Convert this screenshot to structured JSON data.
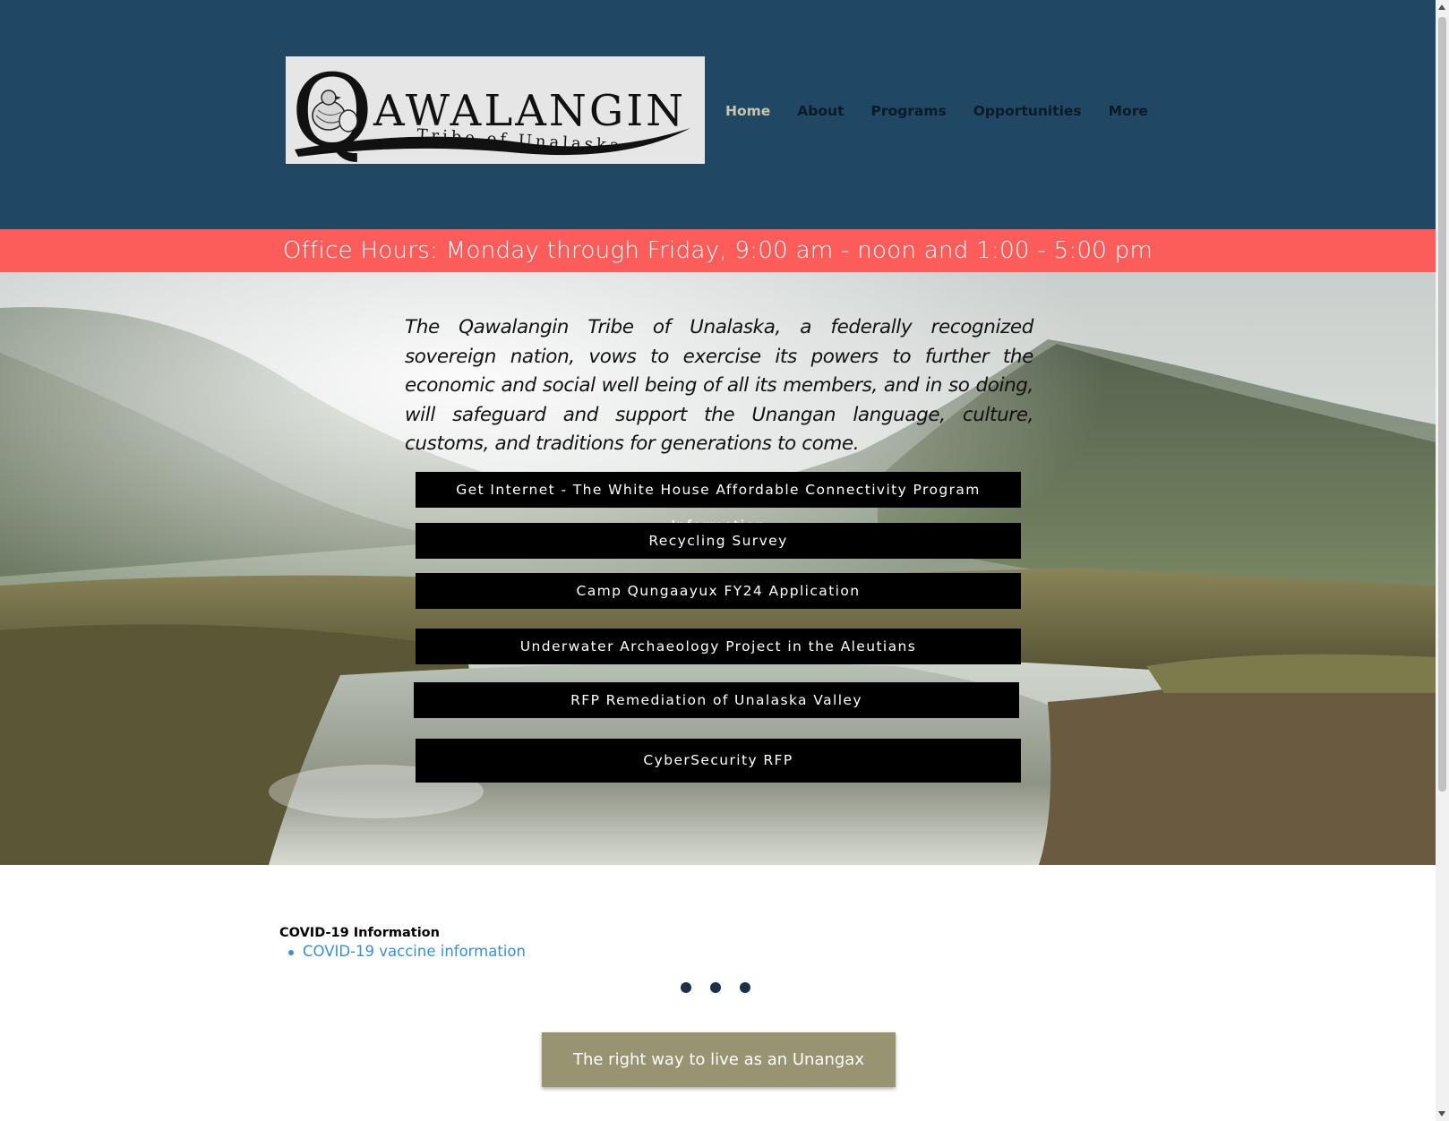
{
  "logo": {
    "big_letter": "Q",
    "name": "AWALANGIN",
    "tagline": "Tribe of Unalaska"
  },
  "nav": {
    "items": [
      {
        "label": "Home",
        "active": true
      },
      {
        "label": "About",
        "active": false
      },
      {
        "label": "Programs",
        "active": false
      },
      {
        "label": "Opportunities",
        "active": false
      },
      {
        "label": "More",
        "active": false
      }
    ]
  },
  "office_hours": "Office Hours: Monday through Friday, 9:00 am - noon and 1:00 - 5:00 pm",
  "mission": "The Qawalangin Tribe of Unalaska, a federally recognized sovereign nation, vows to exercise its powers to further the economic and social well being of all its members, and in so doing, will safeguard and support the Unangan language, culture, customs, and traditions for generations to come.",
  "buttons": [
    {
      "label": "Get Internet - The White House Affordable Connectivity Program Information"
    },
    {
      "label": "Recycling Survey"
    },
    {
      "label": "Camp Qungaayux FY24 Application"
    },
    {
      "label": "Underwater Archaeology Project in the Aleutians"
    },
    {
      "label": "RFP Remediation of Unalaska Valley"
    },
    {
      "label": "CyberSecurity RFP"
    }
  ],
  "covid": {
    "title": "COVID-19 Information",
    "link": "COVID-19 vaccine information"
  },
  "unangax_button": "The right way to live as an Unangax",
  "colors": {
    "header_bg": "#204764",
    "hours_bg": "#fd5d5a",
    "nav_active": "#c8c6a7",
    "link": "#3a8fd4",
    "tan_button": "#989371"
  }
}
